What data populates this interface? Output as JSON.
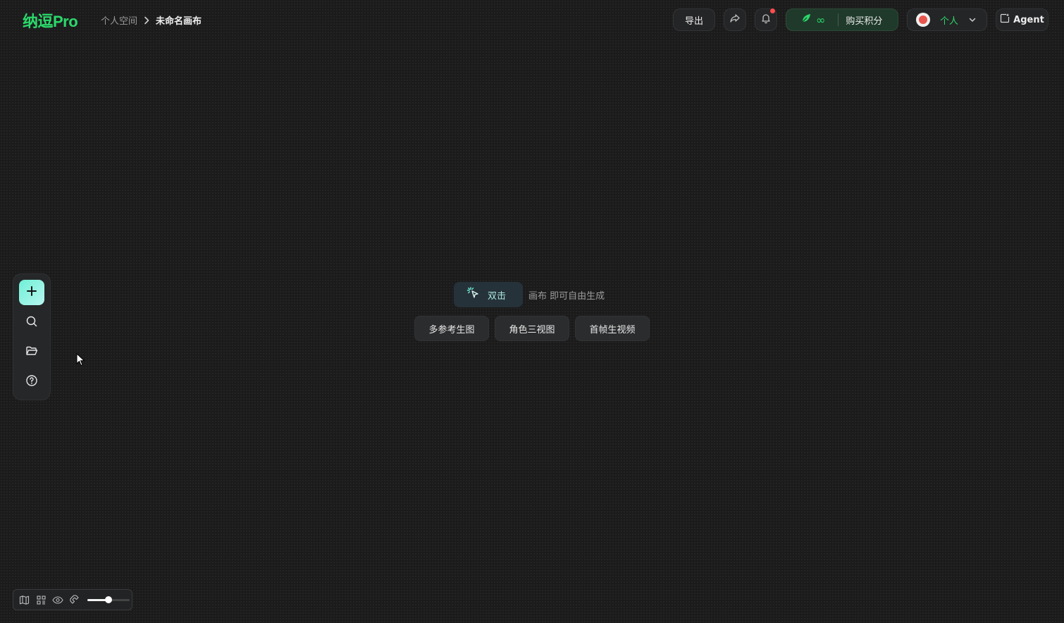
{
  "app": {
    "logo": "纳逗Pro",
    "brand_color": "#2bd96b"
  },
  "breadcrumb": {
    "root": "个人空间",
    "current": "未命名画布"
  },
  "header": {
    "export_label": "导出",
    "share_icon": "share-icon",
    "bell_icon": "bell-icon",
    "has_notification": true,
    "credits_value": "∞",
    "buy_label": "购买积分",
    "account_label": "个人",
    "agent_label": "Agent"
  },
  "left_toolbar": {
    "items": [
      {
        "icon": "plus-icon"
      },
      {
        "icon": "search-icon"
      },
      {
        "icon": "folder-icon"
      },
      {
        "icon": "help-icon"
      }
    ]
  },
  "canvas_hint": {
    "action_label": "双击",
    "hint_text": "画布 即可自由生成",
    "quick_actions": [
      "多参考生图",
      "角色三视图",
      "首帧生视频"
    ]
  },
  "bottom_bar": {
    "icons": [
      "map-icon",
      "grid-icon",
      "eye-icon",
      "magnet-icon"
    ],
    "zoom_level": 0.5
  }
}
